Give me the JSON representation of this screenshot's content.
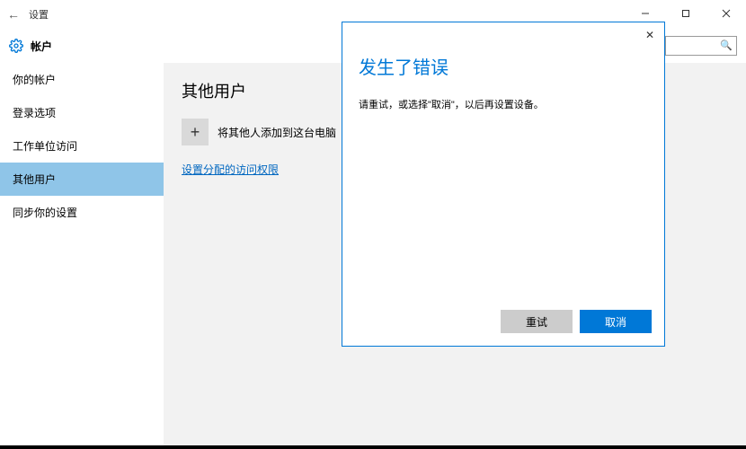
{
  "titlebar": {
    "app_title": "设置"
  },
  "header": {
    "section": "帐户",
    "search_placeholder": ""
  },
  "sidebar": {
    "items": [
      {
        "label": "你的帐户"
      },
      {
        "label": "登录选项"
      },
      {
        "label": "工作单位访问"
      },
      {
        "label": "其他用户"
      },
      {
        "label": "同步你的设置"
      }
    ],
    "selected_index": 3
  },
  "content": {
    "heading": "其他用户",
    "add_label": "将其他人添加到这台电脑",
    "assigned_access_link": "设置分配的访问权限"
  },
  "dialog": {
    "title": "发生了错误",
    "message": "请重试，或选择\"取消\"，以后再设置设备。",
    "retry": "重试",
    "cancel": "取消"
  }
}
